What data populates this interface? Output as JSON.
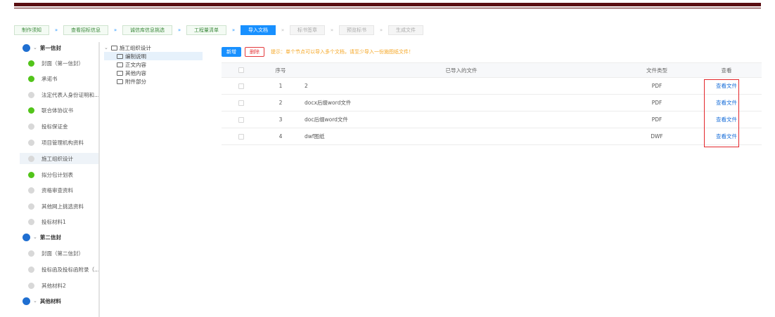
{
  "steps": [
    {
      "label": "制作须知",
      "state": "done"
    },
    {
      "label": "查看招标信息",
      "state": "done"
    },
    {
      "label": "诚信库信息挑选",
      "state": "done"
    },
    {
      "label": "工程量清单",
      "state": "done"
    },
    {
      "label": "导入文档",
      "state": "active"
    },
    {
      "label": "标书签章",
      "state": "todo"
    },
    {
      "label": "预览标书",
      "state": "todo"
    },
    {
      "label": "生成文件",
      "state": "todo"
    }
  ],
  "step_arrow": "»",
  "sidebar": {
    "items": [
      {
        "label": "第一信封",
        "kind": "group"
      },
      {
        "label": "封面（第一信封）",
        "kind": "done"
      },
      {
        "label": "承诺书",
        "kind": "done"
      },
      {
        "label": "法定代表人身份证明和...",
        "kind": "pending"
      },
      {
        "label": "联合体协议书",
        "kind": "done"
      },
      {
        "label": "投标保证金",
        "kind": "pending"
      },
      {
        "label": "项目管理机构资料",
        "kind": "pending"
      },
      {
        "label": "施工组织设计",
        "kind": "pending",
        "active": true
      },
      {
        "label": "拟分包计划表",
        "kind": "done"
      },
      {
        "label": "资格审查资料",
        "kind": "pending"
      },
      {
        "label": "其他网上挑选资料",
        "kind": "pending"
      },
      {
        "label": "投标材料1",
        "kind": "pending"
      },
      {
        "label": "第二信封",
        "kind": "group"
      },
      {
        "label": "封面（第二信封）",
        "kind": "pending"
      },
      {
        "label": "投标函及投标函附录（...",
        "kind": "pending"
      },
      {
        "label": "其他材料2",
        "kind": "pending"
      },
      {
        "label": "其他材料",
        "kind": "group"
      }
    ]
  },
  "tree": {
    "root": "施工组织设计",
    "children": [
      "编制说明",
      "正文内容",
      "其他内容",
      "附件部分"
    ],
    "selected_index": 0
  },
  "toolbar": {
    "add_label": "新增",
    "delete_label": "删除",
    "hint": "提示：单个节点可以导入多个文档，请至少导入一份施图纸文件！"
  },
  "table": {
    "headers": {
      "no": "序号",
      "file": "已导入的文件",
      "type": "文件类型",
      "view": "查看"
    },
    "rows": [
      {
        "no": "1",
        "file": "2",
        "type": "PDF",
        "view": "查看文件"
      },
      {
        "no": "2",
        "file": "docx后缀word文件",
        "type": "PDF",
        "view": "查看文件"
      },
      {
        "no": "3",
        "file": "doc后缀word文件",
        "type": "PDF",
        "view": "查看文件"
      },
      {
        "no": "4",
        "file": "dwf图纸",
        "type": "DWF",
        "view": "查看文件"
      }
    ]
  },
  "colors": {
    "header_bar": "#5a0f12",
    "primary": "#1890ff",
    "done": "#52c41a",
    "highlight_box": "#e3262b",
    "hint": "#f5a623"
  }
}
